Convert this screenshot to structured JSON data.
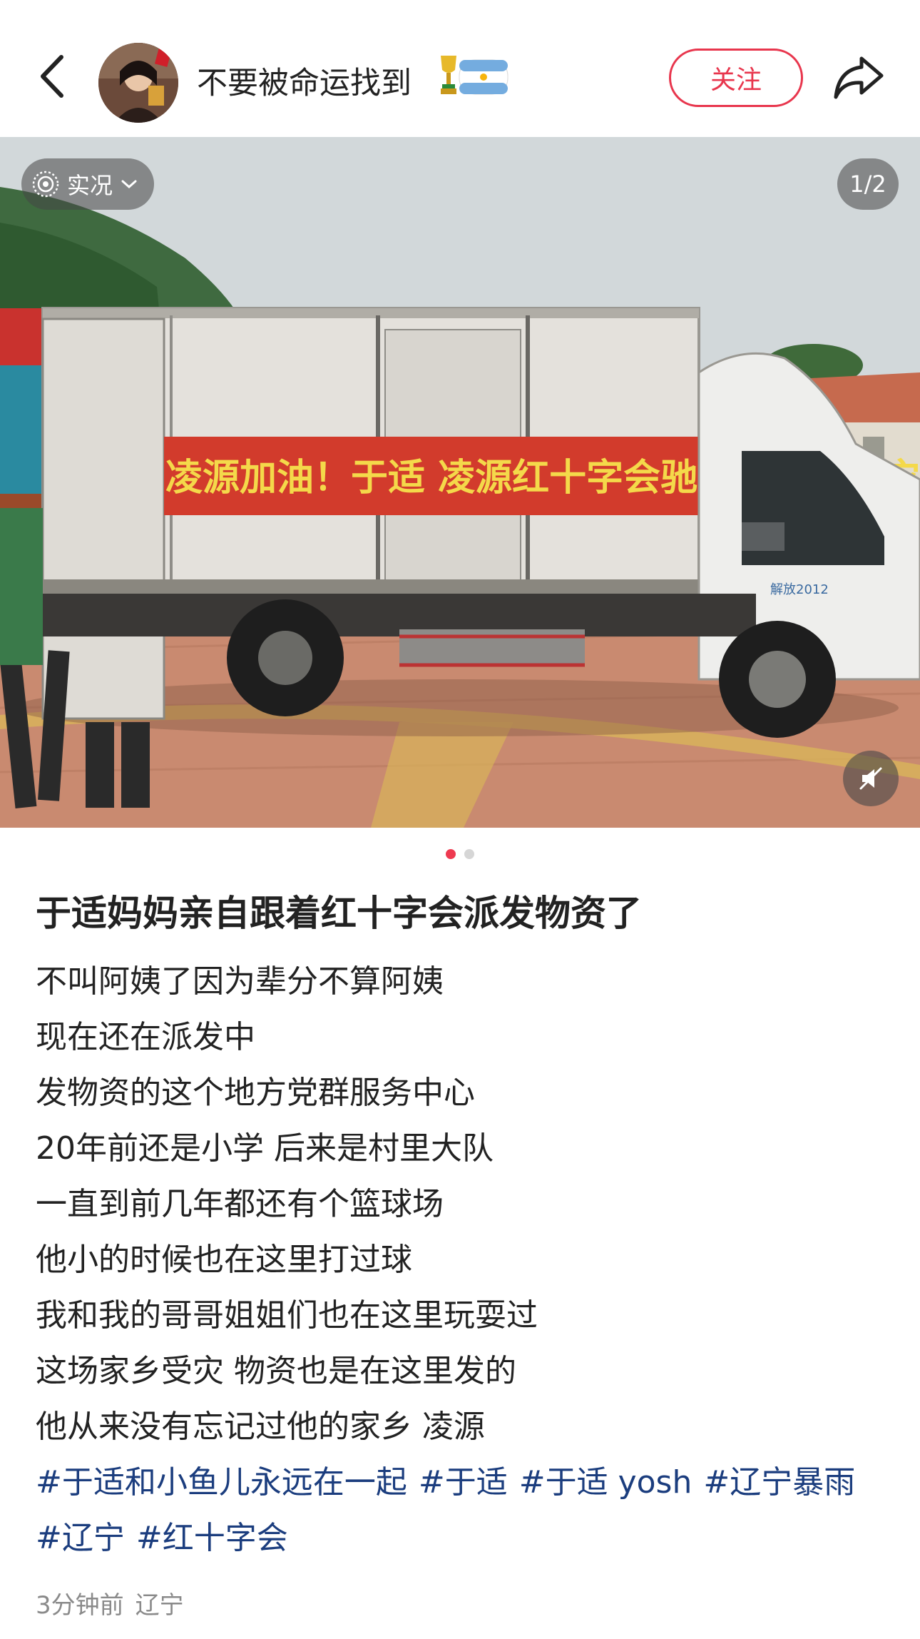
{
  "header": {
    "username": "不要被命运找到",
    "follow_label": "关注"
  },
  "media": {
    "live_label": "实况",
    "page_counter": "1/2",
    "banner_text": "凌源加油！于适 凌源红十字会驰援凌源洪涝灾害",
    "slide_index": 1,
    "slide_total": 2
  },
  "post": {
    "title": "于适妈妈亲自跟着红十字会派发物资了",
    "lines": [
      "不叫阿姨了因为辈分不算阿姨",
      "现在还在派发中",
      "发物资的这个地方党群服务中心",
      "20年前还是小学 后来是村里大队",
      "一直到前几年都还有个篮球场",
      "他小的时候也在这里打过球",
      "我和我的哥哥姐姐们也在这里玩耍过",
      "这场家乡受灾 物资也是在这里发的",
      "他从来没有忘记过他的家乡 凌源"
    ],
    "tags": [
      "#于适和小鱼儿永远在一起",
      "#于适",
      "#于适 yosh",
      "#辽宁暴雨",
      "#辽宁",
      "#红十字会"
    ],
    "time": "3分钟前",
    "location": "辽宁"
  },
  "colors": {
    "accent": "#e8364d",
    "tag": "#1b3d7e",
    "meta": "#8a8a8a"
  }
}
